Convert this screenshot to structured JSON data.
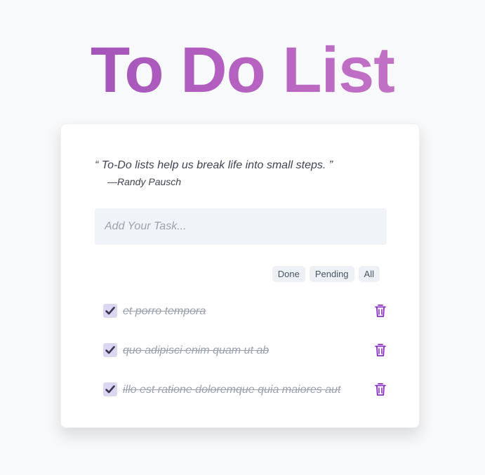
{
  "app": {
    "title": "To Do List"
  },
  "quote": {
    "text": "“ To-Do lists help us break life into small steps. ”",
    "author": "—Randy Pausch"
  },
  "input": {
    "placeholder": "Add Your Task...",
    "value": ""
  },
  "filters": [
    "Done",
    "Pending",
    "All"
  ],
  "tasks": [
    {
      "text": "et porro tempora",
      "done": true
    },
    {
      "text": "quo adipisci enim quam ut ab",
      "done": true
    },
    {
      "text": "illo est ratione doloremque quia maiores aut",
      "done": true
    }
  ],
  "colors": {
    "title_gradient_start": "#9a4fb5",
    "title_gradient_end": "#c97cc8",
    "trash_icon": "#8b2fc9",
    "checkbox_bg": "#ddd6f3",
    "checkmark": "#3b3550"
  },
  "icons": {
    "checkbox": "checkmark-icon",
    "delete": "trash-icon"
  }
}
